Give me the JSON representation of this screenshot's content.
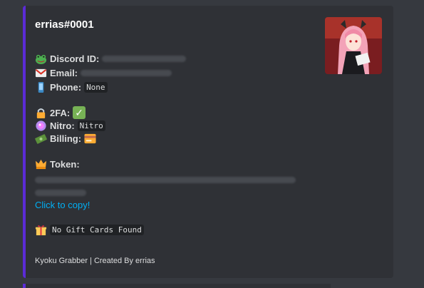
{
  "embed": {
    "title": "errias#0001",
    "fields": {
      "discord_id_label": "Discord ID:",
      "email_label": "Email:",
      "phone_label": "Phone:",
      "phone_value": "None",
      "twofa_label": "2FA:",
      "nitro_label": "Nitro:",
      "nitro_value": "Nitro",
      "billing_label": "Billing:",
      "token_label": "Token:"
    },
    "copy_link": "Click to copy!",
    "gift_cards": "No Gift Cards Found",
    "footer": "Kyoku Grabber | Created By errias"
  },
  "colors": {
    "accent": "#5b2bd6",
    "link": "#00aff4",
    "background": "#36393f",
    "embed_background": "#2f3136"
  },
  "icons": [
    "frog-emoji-icon",
    "mail-icon",
    "phone-icon",
    "lock-icon",
    "check-mark-icon",
    "nitro-gem-icon",
    "money-icon",
    "credit-card-icon",
    "crown-icon",
    "gift-icon"
  ]
}
